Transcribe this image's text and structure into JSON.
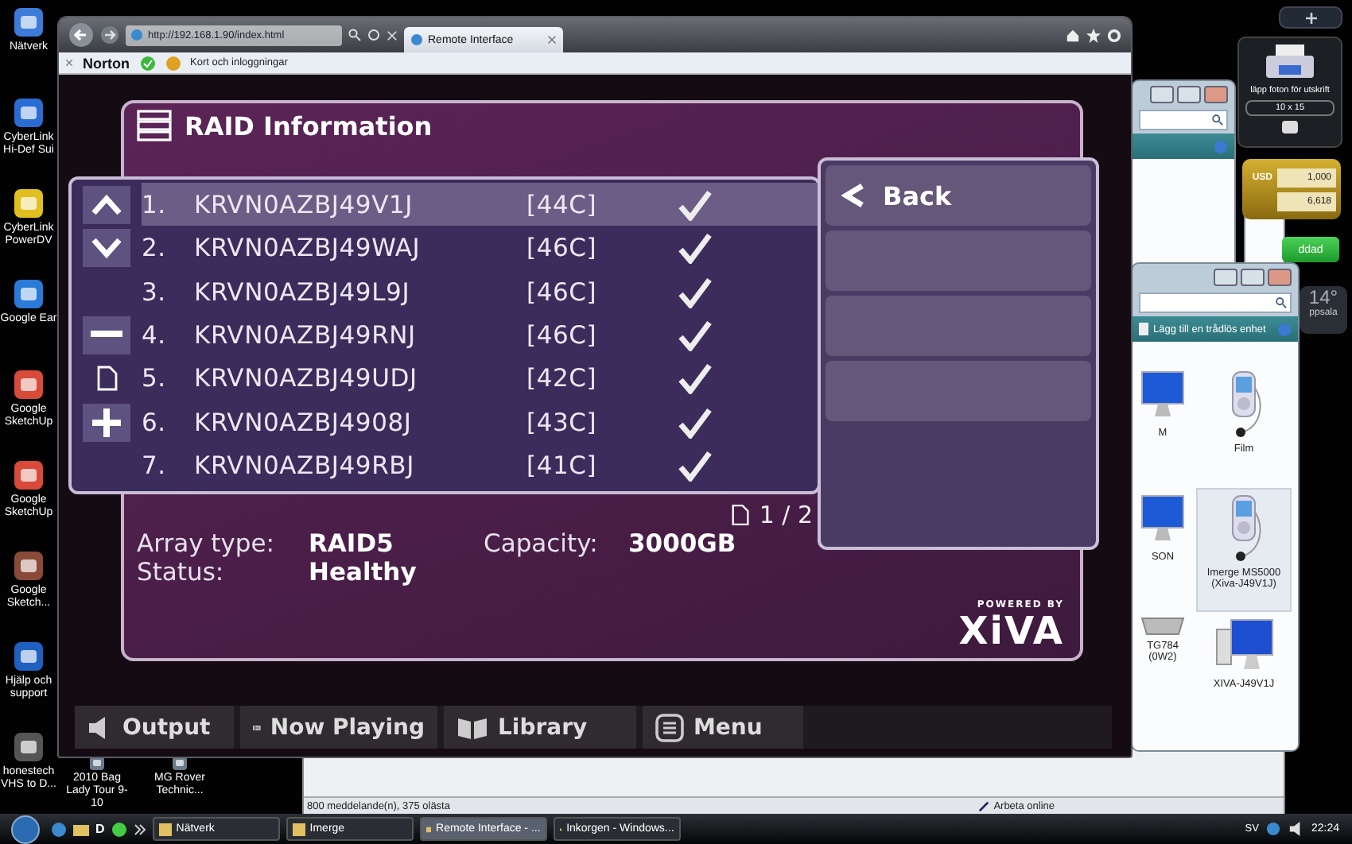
{
  "desktop_icons": [
    {
      "label": "Nätverk"
    },
    {
      "label": "CyberLink Hi-Def Sui"
    },
    {
      "label": "CyberLink PowerDV"
    },
    {
      "label": "Google Ear"
    },
    {
      "label": "Google SketchUp"
    },
    {
      "label": "Google SketchUp"
    },
    {
      "label": "Google Sketch..."
    },
    {
      "label": "Hjälp och support"
    },
    {
      "label": "honestech VHS to D..."
    }
  ],
  "desktop_icons_bottom": [
    {
      "label": "2010 Bag Lady Tour 9-10"
    },
    {
      "label": "MG Rover Technic..."
    }
  ],
  "browser": {
    "address": "http://192.168.1.90/index.html",
    "tab": "Remote Interface",
    "toolbar_brand": "Norton",
    "toolbar_cards": "Kort och inloggningar"
  },
  "raid": {
    "title": "RAID Information",
    "drives": [
      {
        "number": "1.",
        "serial": "KRVN0AZBJ49V1J",
        "temperature": "[44C]",
        "ok": true,
        "selected": true,
        "kind": "up"
      },
      {
        "number": "2.",
        "serial": "KRVN0AZBJ49WAJ",
        "temperature": "[46C]",
        "ok": true,
        "selected": false,
        "kind": "down"
      },
      {
        "number": "3.",
        "serial": "KRVN0AZBJ49L9J",
        "temperature": "[46C]",
        "ok": true,
        "selected": false,
        "kind": "plain"
      },
      {
        "number": "4.",
        "serial": "KRVN0AZBJ49RNJ",
        "temperature": "[46C]",
        "ok": true,
        "selected": false,
        "kind": "minus"
      },
      {
        "number": "5.",
        "serial": "KRVN0AZBJ49UDJ",
        "temperature": "[42C]",
        "ok": true,
        "selected": false,
        "kind": "page"
      },
      {
        "number": "6.",
        "serial": "KRVN0AZBJ4908J",
        "temperature": "[43C]",
        "ok": true,
        "selected": false,
        "kind": "plus"
      },
      {
        "number": "7.",
        "serial": "KRVN0AZBJ49RBJ",
        "temperature": "[41C]",
        "ok": true,
        "selected": false,
        "kind": "plain"
      }
    ],
    "menu": [
      {
        "kind": "back",
        "label": "Back"
      },
      {
        "kind": "empty"
      },
      {
        "kind": "empty"
      },
      {
        "kind": "empty"
      }
    ],
    "page": "1 / 2",
    "array_type_label": "Array type:",
    "array_type": "RAID5",
    "capacity_label": "Capacity:",
    "capacity": "3000GB",
    "status_label": "Status:",
    "status": "Healthy",
    "powered_by": "POWERED BY",
    "logo": "XiVA"
  },
  "nav": [
    {
      "kind": "output",
      "label": "Output"
    },
    {
      "kind": "now_playing",
      "label": "Now Playing"
    },
    {
      "kind": "library",
      "label": "Library"
    },
    {
      "kind": "menu",
      "label": "Menu"
    }
  ],
  "gadgets": {
    "printer_text": "läpp foton för utskrift",
    "printer_size": "10 x 15",
    "currency_code": "USD",
    "currency_from": "1,000",
    "currency_to": "6,618",
    "green_button": "ddad",
    "temperature": "14°",
    "city": "ppsala"
  },
  "explorer": {
    "task": "Lägg till en trådlös enhet",
    "items": [
      {
        "label": "M",
        "kind": "monitor",
        "selected": false
      },
      {
        "label": "Film",
        "kind": "player",
        "selected": false
      },
      {
        "label": "SON",
        "kind": "monitor",
        "selected": false
      },
      {
        "label": "Imerge MS5000 (Xiva-J49V1J)",
        "kind": "player",
        "selected": true
      },
      {
        "label": "TG784 (0W2)",
        "kind": "router",
        "selected": false
      },
      {
        "label": "XIVA-J49V1J",
        "kind": "computer",
        "selected": false
      }
    ]
  },
  "mail": {
    "status": "800 meddelande(n), 375 olästa",
    "online": "Arbeta online"
  },
  "taskbar": {
    "quick_text": "D",
    "buttons": [
      {
        "label": "Nätverk",
        "selected": false
      },
      {
        "label": "Imerge",
        "selected": false
      },
      {
        "label": "Remote Interface - ...",
        "selected": true
      },
      {
        "label": "Inkorgen - Windows...",
        "selected": false
      }
    ],
    "language": "SV",
    "time": "22:24"
  }
}
